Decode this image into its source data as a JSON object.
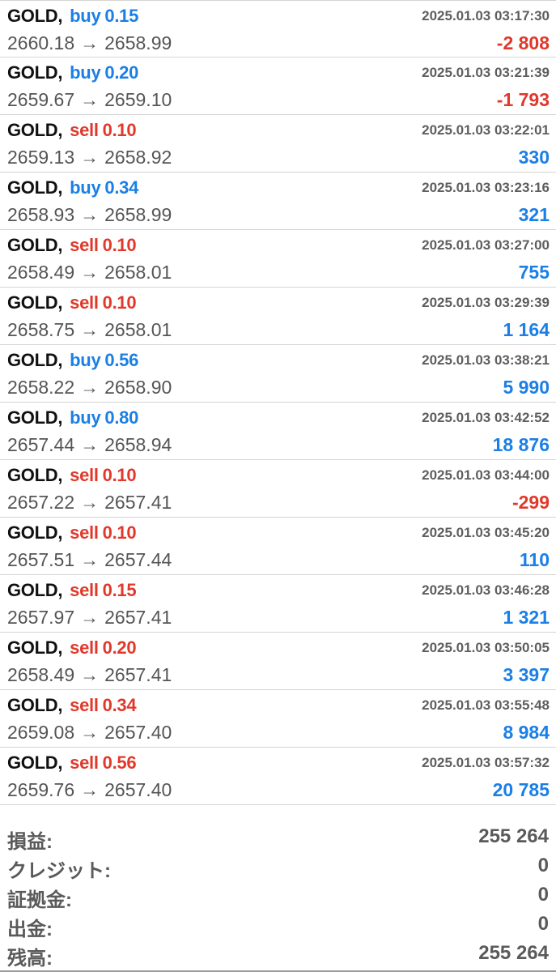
{
  "deals": [
    {
      "symbol": "GOLD",
      "sep": ",",
      "side": "buy",
      "volume": "0.15",
      "time": "2025.01.03 03:17:30",
      "open_price": "2660.18",
      "arrow": "→",
      "close_price": "2658.99",
      "profit": "-2 808",
      "profit_sign": "neg"
    },
    {
      "symbol": "GOLD",
      "sep": ",",
      "side": "buy",
      "volume": "0.20",
      "time": "2025.01.03 03:21:39",
      "open_price": "2659.67",
      "arrow": "→",
      "close_price": "2659.10",
      "profit": "-1 793",
      "profit_sign": "neg"
    },
    {
      "symbol": "GOLD",
      "sep": ",",
      "side": "sell",
      "volume": "0.10",
      "time": "2025.01.03 03:22:01",
      "open_price": "2659.13",
      "arrow": "→",
      "close_price": "2658.92",
      "profit": "330",
      "profit_sign": "pos"
    },
    {
      "symbol": "GOLD",
      "sep": ",",
      "side": "buy",
      "volume": "0.34",
      "time": "2025.01.03 03:23:16",
      "open_price": "2658.93",
      "arrow": "→",
      "close_price": "2658.99",
      "profit": "321",
      "profit_sign": "pos"
    },
    {
      "symbol": "GOLD",
      "sep": ",",
      "side": "sell",
      "volume": "0.10",
      "time": "2025.01.03 03:27:00",
      "open_price": "2658.49",
      "arrow": "→",
      "close_price": "2658.01",
      "profit": "755",
      "profit_sign": "pos"
    },
    {
      "symbol": "GOLD",
      "sep": ",",
      "side": "sell",
      "volume": "0.10",
      "time": "2025.01.03 03:29:39",
      "open_price": "2658.75",
      "arrow": "→",
      "close_price": "2658.01",
      "profit": "1 164",
      "profit_sign": "pos"
    },
    {
      "symbol": "GOLD",
      "sep": ",",
      "side": "buy",
      "volume": "0.56",
      "time": "2025.01.03 03:38:21",
      "open_price": "2658.22",
      "arrow": "→",
      "close_price": "2658.90",
      "profit": "5 990",
      "profit_sign": "pos"
    },
    {
      "symbol": "GOLD",
      "sep": ",",
      "side": "buy",
      "volume": "0.80",
      "time": "2025.01.03 03:42:52",
      "open_price": "2657.44",
      "arrow": "→",
      "close_price": "2658.94",
      "profit": "18 876",
      "profit_sign": "pos"
    },
    {
      "symbol": "GOLD",
      "sep": ",",
      "side": "sell",
      "volume": "0.10",
      "time": "2025.01.03 03:44:00",
      "open_price": "2657.22",
      "arrow": "→",
      "close_price": "2657.41",
      "profit": "-299",
      "profit_sign": "neg"
    },
    {
      "symbol": "GOLD",
      "sep": ",",
      "side": "sell",
      "volume": "0.10",
      "time": "2025.01.03 03:45:20",
      "open_price": "2657.51",
      "arrow": "→",
      "close_price": "2657.44",
      "profit": "110",
      "profit_sign": "pos"
    },
    {
      "symbol": "GOLD",
      "sep": ",",
      "side": "sell",
      "volume": "0.15",
      "time": "2025.01.03 03:46:28",
      "open_price": "2657.97",
      "arrow": "→",
      "close_price": "2657.41",
      "profit": "1 321",
      "profit_sign": "pos"
    },
    {
      "symbol": "GOLD",
      "sep": ",",
      "side": "sell",
      "volume": "0.20",
      "time": "2025.01.03 03:50:05",
      "open_price": "2658.49",
      "arrow": "→",
      "close_price": "2657.41",
      "profit": "3 397",
      "profit_sign": "pos"
    },
    {
      "symbol": "GOLD",
      "sep": ",",
      "side": "sell",
      "volume": "0.34",
      "time": "2025.01.03 03:55:48",
      "open_price": "2659.08",
      "arrow": "→",
      "close_price": "2657.40",
      "profit": "8 984",
      "profit_sign": "pos"
    },
    {
      "symbol": "GOLD",
      "sep": ",",
      "side": "sell",
      "volume": "0.56",
      "time": "2025.01.03 03:57:32",
      "open_price": "2659.76",
      "arrow": "→",
      "close_price": "2657.40",
      "profit": "20 785",
      "profit_sign": "pos"
    }
  ],
  "summary": [
    {
      "key": "profit",
      "label": "損益:",
      "value": "255 264"
    },
    {
      "key": "credit",
      "label": "クレジット:",
      "value": "0"
    },
    {
      "key": "deposit",
      "label": "証拠金:",
      "value": "0"
    },
    {
      "key": "withdrawal",
      "label": "出金:",
      "value": "0"
    },
    {
      "key": "balance",
      "label": "残高:",
      "value": "255 264"
    }
  ],
  "colors": {
    "buy": "#1a7fe6",
    "sell": "#e0392b",
    "profit_positive": "#1a7fe6",
    "profit_negative": "#e0392b",
    "divider": "#d4d4d4"
  }
}
